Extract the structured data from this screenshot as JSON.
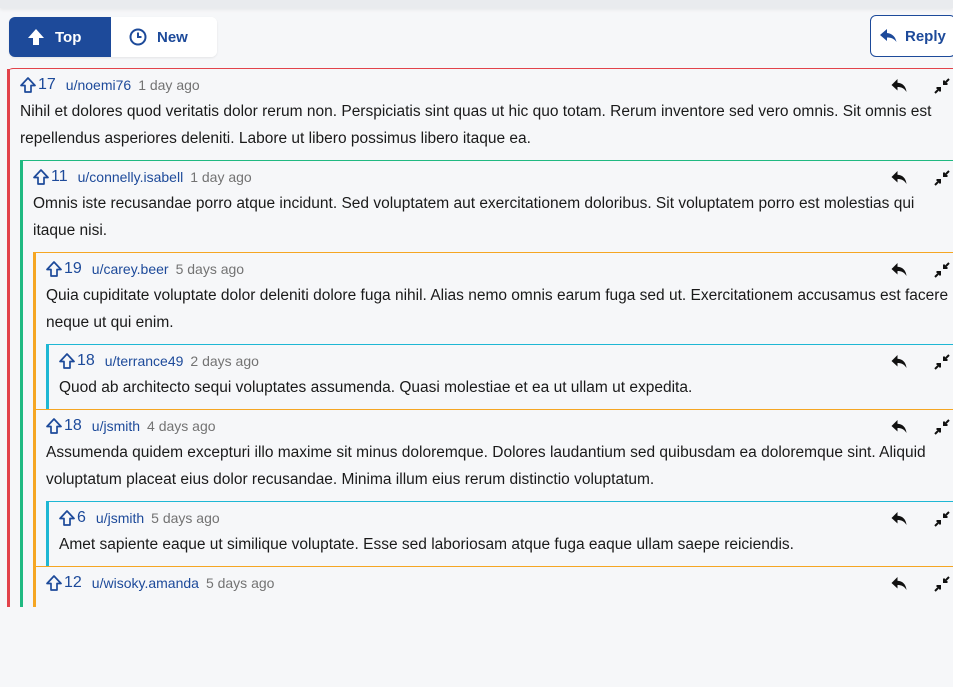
{
  "sort": {
    "top_label": "Top",
    "new_label": "New"
  },
  "reply_label": "Reply",
  "colors": {
    "accent": "#1d4a9a",
    "level1": "#e2434b",
    "level2": "#1fb981",
    "level3": "#f5a623",
    "level4": "#1eb7d4"
  },
  "comments": [
    {
      "score": "17",
      "author": "u/noemi76",
      "age": "1 day ago",
      "body": "Nihil et dolores quod veritatis dolor rerum non. Perspiciatis sint quas ut hic quo totam. Rerum inventore sed vero omnis. Sit omnis est repellendus asperiores deleniti. Labore ut libero possimus libero itaque ea."
    },
    {
      "score": "11",
      "author": "u/connelly.isabell",
      "age": "1 day ago",
      "body": "Omnis iste recusandae porro atque incidunt. Sed voluptatem aut exercitationem doloribus. Sit voluptatem porro est molestias qui itaque nisi."
    },
    {
      "score": "19",
      "author": "u/carey.beer",
      "age": "5 days ago",
      "body": "Quia cupiditate voluptate dolor deleniti dolore fuga nihil. Alias nemo omnis earum fuga sed ut. Exercitationem accusamus est facere neque ut qui enim."
    },
    {
      "score": "18",
      "author": "u/terrance49",
      "age": "2 days ago",
      "body": "Quod ab architecto sequi voluptates assumenda. Quasi molestiae et ea ut ullam ut expedita."
    },
    {
      "score": "18",
      "author": "u/jsmith",
      "age": "4 days ago",
      "body": "Assumenda quidem excepturi illo maxime sit minus doloremque. Dolores laudantium sed quibusdam ea doloremque sint. Aliquid voluptatum placeat eius dolor recusandae. Minima illum eius rerum distinctio voluptatum."
    },
    {
      "score": "6",
      "author": "u/jsmith",
      "age": "5 days ago",
      "body": "Amet sapiente eaque ut similique voluptate. Esse sed laboriosam atque fuga eaque ullam saepe reiciendis."
    },
    {
      "score": "12",
      "author": "u/wisoky.amanda",
      "age": "5 days ago",
      "body": ""
    }
  ]
}
